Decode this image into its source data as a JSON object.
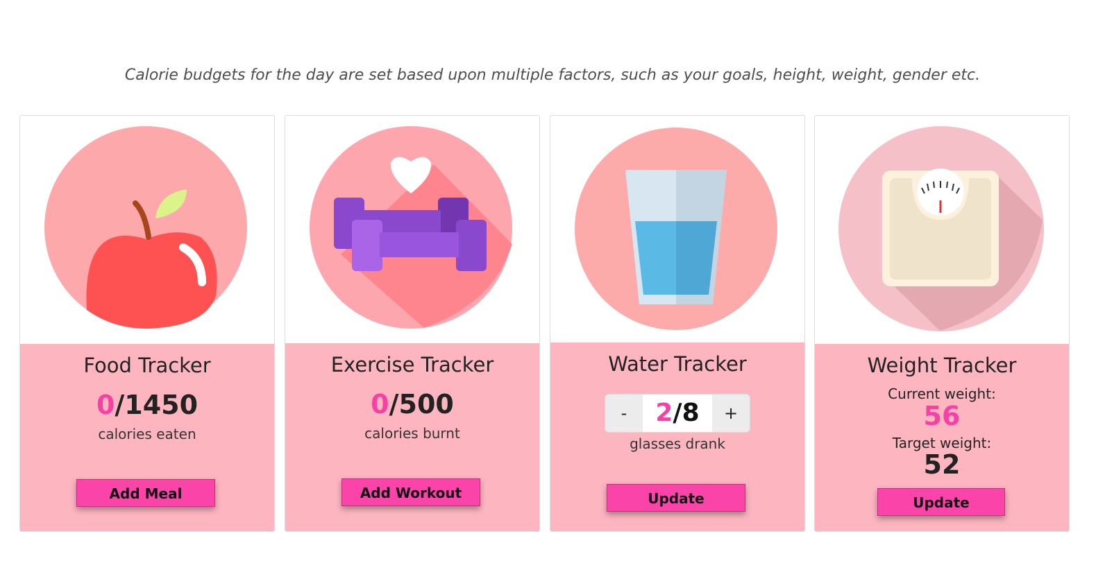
{
  "subtitle": "Calorie budgets for the day are set based upon multiple factors, such as your goals, height, weight, gender etc.",
  "colors": {
    "accent": "#fa44aa",
    "card_body": "#fdb5c0",
    "highlight": "#f541a5"
  },
  "food": {
    "icon": "apple-icon",
    "title": "Food Tracker",
    "current": "0",
    "total": "/1450",
    "unit": "calories eaten",
    "button": "Add Meal"
  },
  "exercise": {
    "icon": "dumbbell-heart-icon",
    "title": "Exercise Tracker",
    "current": "0",
    "total": "/500",
    "unit": "calories burnt",
    "button": "Add Workout"
  },
  "water": {
    "icon": "water-glass-icon",
    "title": "Water Tracker",
    "minus": "-",
    "plus": "+",
    "current": "2",
    "total": "/8",
    "unit": "glasses drank",
    "button": "Update"
  },
  "weight": {
    "icon": "weighing-scale-icon",
    "title": "Weight Tracker",
    "current_label": "Current weight:",
    "current_value": "56",
    "target_label": "Target weight:",
    "target_value": "52",
    "button": "Update"
  }
}
